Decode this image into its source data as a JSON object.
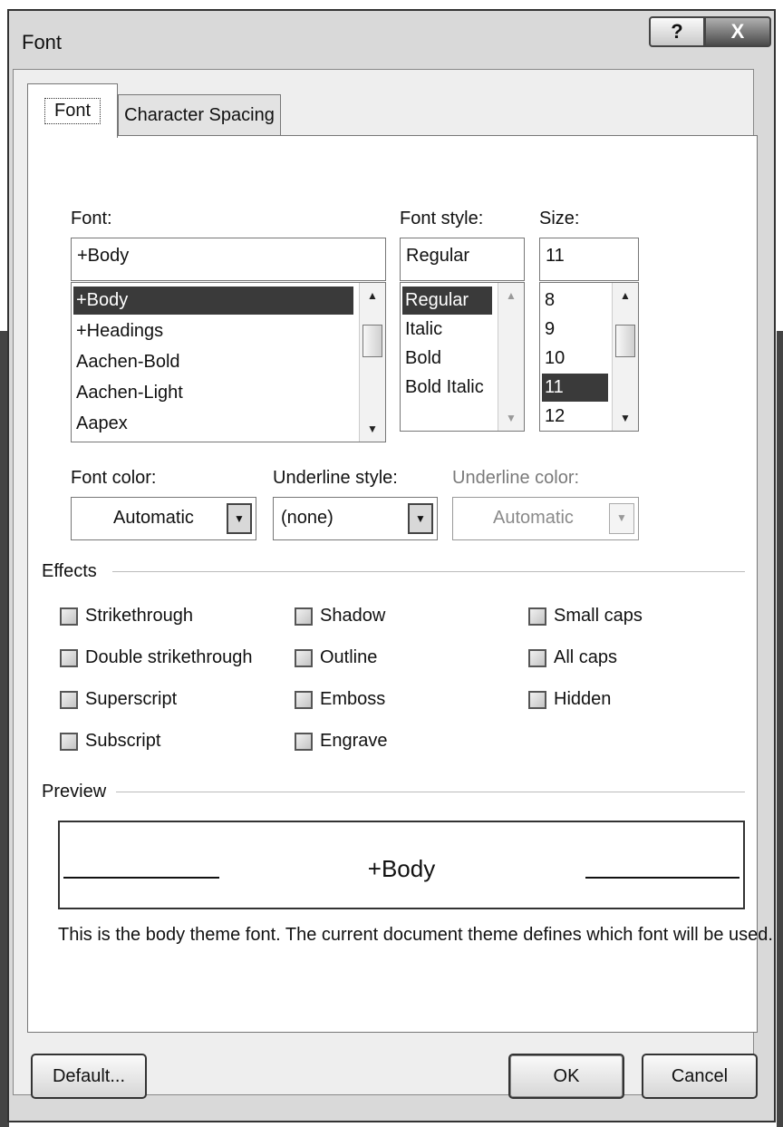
{
  "window": {
    "title": "Font",
    "help_label": "?",
    "close_label": "X"
  },
  "tabs": [
    {
      "label": "Font",
      "active": true
    },
    {
      "label": "Character Spacing",
      "active": false
    }
  ],
  "font": {
    "label": "Font:",
    "value": "+Body",
    "items": [
      "+Body",
      "+Headings",
      "Aachen-Bold",
      "Aachen-Light",
      "Aapex"
    ],
    "selected": "+Body"
  },
  "font_style": {
    "label": "Font style:",
    "value": "Regular",
    "items": [
      "Regular",
      "Italic",
      "Bold",
      "Bold Italic"
    ],
    "selected": "Regular"
  },
  "size": {
    "label": "Size:",
    "value": "11",
    "items": [
      "8",
      "9",
      "10",
      "11",
      "12"
    ],
    "selected": "11"
  },
  "font_color": {
    "label": "Font color:",
    "value": "Automatic"
  },
  "underline_style": {
    "label": "Underline style:",
    "value": "(none)"
  },
  "underline_color": {
    "label": "Underline color:",
    "value": "Automatic",
    "enabled": false
  },
  "effects": {
    "label": "Effects",
    "col1": [
      {
        "label": "Strikethrough",
        "checked": false
      },
      {
        "label": "Double strikethrough",
        "checked": false
      },
      {
        "label": "Superscript",
        "checked": false
      },
      {
        "label": "Subscript",
        "checked": false
      }
    ],
    "col2": [
      {
        "label": "Shadow",
        "checked": false
      },
      {
        "label": "Outline",
        "checked": false
      },
      {
        "label": "Emboss",
        "checked": false
      },
      {
        "label": "Engrave",
        "checked": false
      }
    ],
    "col3": [
      {
        "label": "Small caps",
        "checked": false
      },
      {
        "label": "All caps",
        "checked": false
      },
      {
        "label": "Hidden",
        "checked": false
      }
    ]
  },
  "preview": {
    "label": "Preview",
    "sample": "+Body",
    "description": "This is the body theme font. The current document theme defines which font will be used."
  },
  "buttons": {
    "default": "Default...",
    "ok": "OK",
    "cancel": "Cancel"
  },
  "icons": [
    "help-icon",
    "close-icon",
    "scroll-up-icon",
    "scroll-down-icon",
    "dropdown-arrow-icon",
    "checkbox-icon"
  ]
}
